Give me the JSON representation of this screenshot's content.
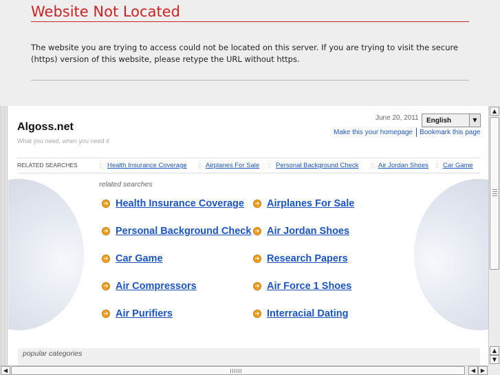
{
  "notice": {
    "title": "Website Not Located",
    "message": "The website you are trying to access could not be located on this server. If you are trying to visit the secure (https) version of this website, please retype the URL without https."
  },
  "site": {
    "title": "Algoss.net",
    "tagline": "What you need, when you need it",
    "date": "June 20, 2011",
    "language": "English",
    "make_homepage": "Make this your homepage",
    "bookmark": "Bookmark this page"
  },
  "related_bar": {
    "label": "RELATED SEARCHES",
    "links": [
      "Health Insurance Coverage",
      "Airplanes For Sale",
      "Personal Background Check",
      "Air Jordan Shoes",
      "Car Game"
    ]
  },
  "related": {
    "label": "related searches",
    "left": [
      "Health Insurance Coverage",
      "Personal Background Check",
      "Car Game",
      "Air Compressors",
      "Air Purifiers"
    ],
    "right": [
      "Airplanes For Sale",
      "Air Jordan Shoes",
      "Research Papers",
      "Air Force 1 Shoes",
      "Interracial Dating"
    ]
  },
  "popular": {
    "label": "popular categories"
  },
  "icons": {
    "keyword_bullet": "arrow-right-circle-icon",
    "scroll_up": "arrow-up-icon",
    "scroll_down": "arrow-down-icon",
    "scroll_left": "arrow-left-icon",
    "scroll_right": "arrow-right-icon",
    "dropdown": "chevron-down-icon"
  },
  "colors": {
    "error_title": "#cc2222",
    "link": "#1a55c4",
    "bullet": "#f0a020"
  }
}
